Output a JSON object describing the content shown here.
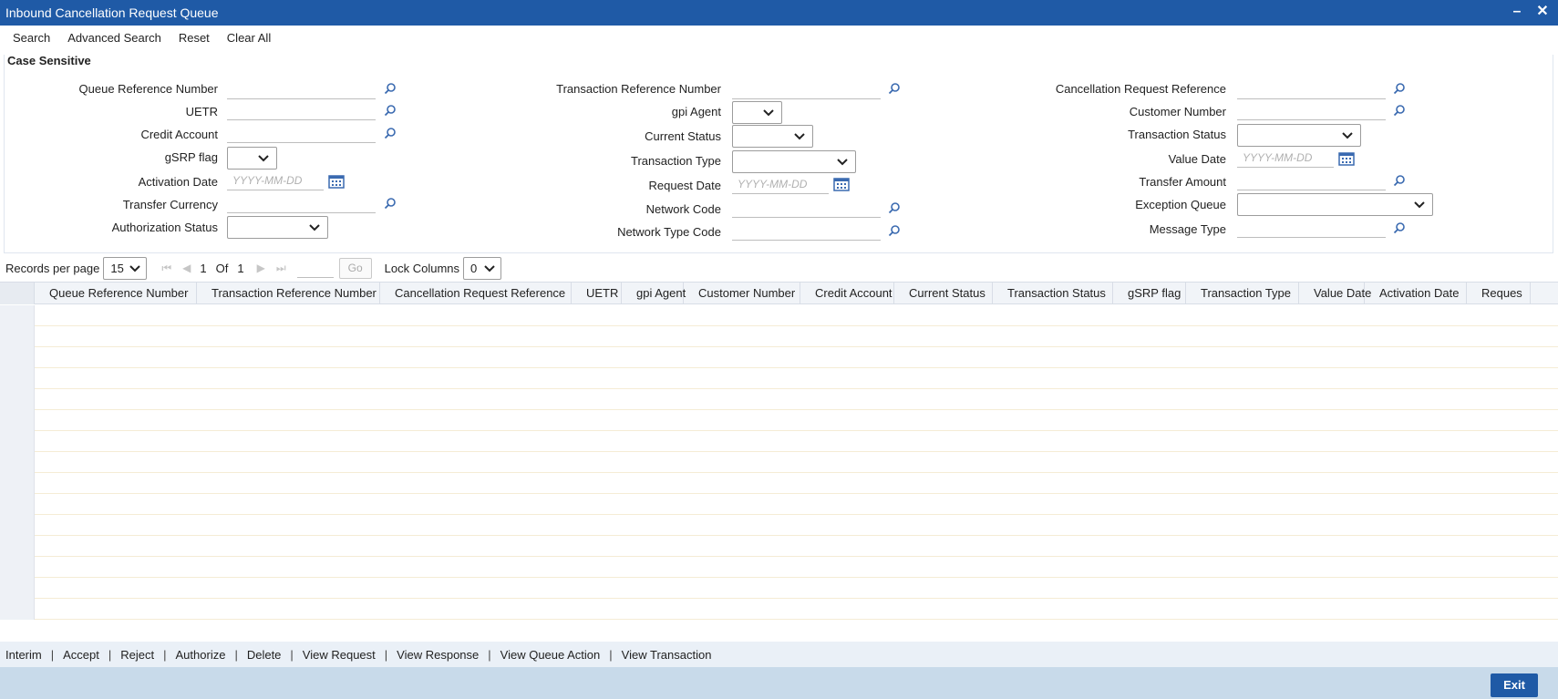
{
  "window": {
    "title": "Inbound Cancellation Request Queue",
    "minimize": "–",
    "close": "✕"
  },
  "toolbar": {
    "search": "Search",
    "advanced_search": "Advanced Search",
    "reset": "Reset",
    "clear_all": "Clear All"
  },
  "section": {
    "legend": "Case Sensitive"
  },
  "fields": {
    "queue_ref": "Queue Reference Number",
    "uetr": "UETR",
    "credit_account": "Credit Account",
    "gsrp_flag": "gSRP flag",
    "activation_date": "Activation Date",
    "transfer_currency": "Transfer Currency",
    "authorization_status": "Authorization Status",
    "txn_ref": "Transaction Reference Number",
    "gpi_agent": "gpi Agent",
    "current_status": "Current Status",
    "txn_type": "Transaction Type",
    "request_date": "Request Date",
    "network_code": "Network Code",
    "network_type_code": "Network Type Code",
    "cancel_req_ref": "Cancellation Request Reference",
    "customer_number": "Customer Number",
    "txn_status": "Transaction Status",
    "value_date": "Value Date",
    "transfer_amount": "Transfer Amount",
    "exception_queue": "Exception Queue",
    "message_type": "Message Type",
    "date_placeholder": "YYYY-MM-DD"
  },
  "pager": {
    "records_label": "Records per page",
    "records_value": "15",
    "page": "1",
    "of_label": "Of",
    "total": "1",
    "go": "Go",
    "lock_label": "Lock Columns",
    "lock_value": "0"
  },
  "grid": {
    "columns": [
      "Queue Reference Number",
      "Transaction Reference Number",
      "Cancellation Request Reference",
      "UETR",
      "gpi Agent",
      "Customer Number",
      "Credit Account",
      "Current Status",
      "Transaction Status",
      "gSRP flag",
      "Transaction Type",
      "Value Date",
      "Activation Date",
      "Reques"
    ]
  },
  "actions": [
    "Interim",
    "Accept",
    "Reject",
    "Authorize",
    "Delete",
    "View Request",
    "View Response",
    "View Queue Action",
    "View Transaction"
  ],
  "footer": {
    "exit": "Exit"
  },
  "colors": {
    "title_bar": "#1f5aa6",
    "footer": "#c8daea",
    "action_bar": "#eaf0f7"
  }
}
